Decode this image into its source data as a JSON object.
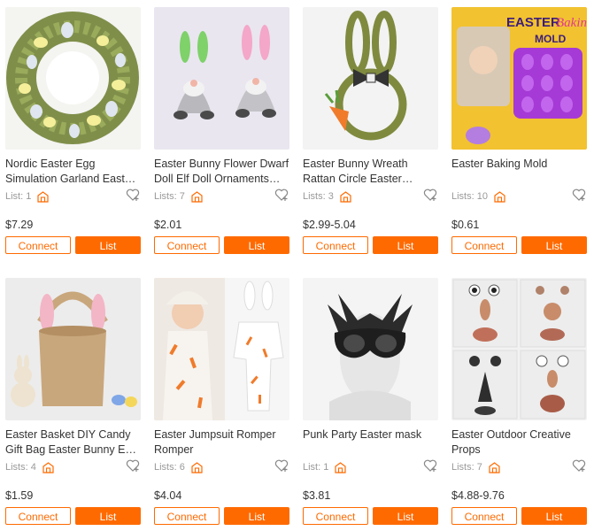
{
  "colors": {
    "accent": "#ff6a00",
    "text": "#333333",
    "muted": "#999999"
  },
  "products": [
    {
      "title": "Nordic Easter Egg Simulation Garland Easter Decoration",
      "lists_label": "List: 1",
      "price": "$7.29",
      "connect": "Connect",
      "list": "List"
    },
    {
      "title": "Easter Bunny Flower Dwarf Doll Elf Doll Ornaments Decoration",
      "lists_label": "Lists: 7",
      "price": "$2.01",
      "connect": "Connect",
      "list": "List"
    },
    {
      "title": "Easter Bunny Wreath Rattan Circle Easter Decoration",
      "lists_label": "Lists: 3",
      "price": "$2.99-5.04",
      "connect": "Connect",
      "list": "List"
    },
    {
      "title": "Easter Baking Mold",
      "lists_label": "Lists: 10",
      "price": "$0.61",
      "connect": "Connect",
      "list": "List",
      "image_text": {
        "line1": "EASTER",
        "line2": "Baking",
        "line3": "MOLD"
      }
    },
    {
      "title": "Easter Basket DIY Candy Gift Bag Easter Bunny Ear Basket",
      "lists_label": "Lists: 4",
      "price": "$1.59",
      "connect": "Connect",
      "list": "List"
    },
    {
      "title": "Easter Jumpsuit Romper Romper",
      "lists_label": "Lists: 6",
      "price": "$4.04",
      "connect": "Connect",
      "list": "List"
    },
    {
      "title": "Punk Party Easter mask",
      "lists_label": "List: 1",
      "price": "$3.81",
      "connect": "Connect",
      "list": "List"
    },
    {
      "title": "Easter Outdoor Creative Props",
      "lists_label": "Lists: 7",
      "price": "$4.88-9.76",
      "connect": "Connect",
      "list": "List"
    }
  ]
}
